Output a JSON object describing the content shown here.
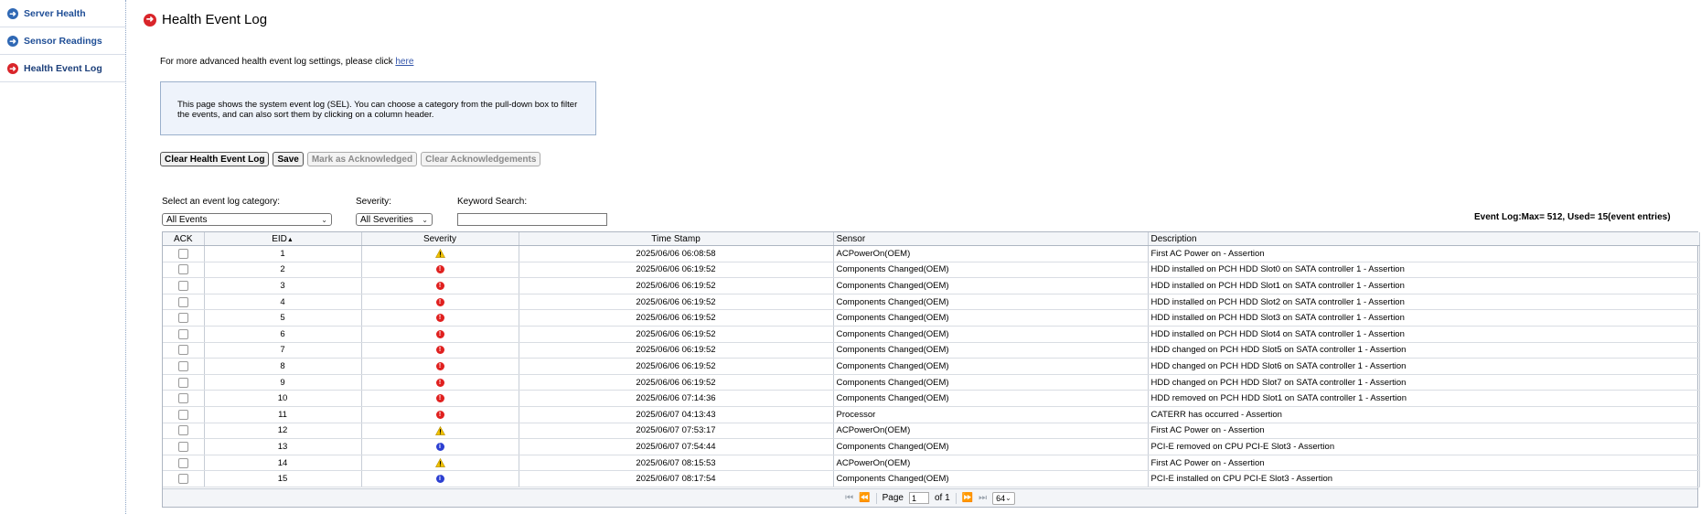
{
  "sidebar": {
    "items": [
      {
        "label": "Server Health",
        "icon": "arrow-right-circle-icon",
        "active": false
      },
      {
        "label": "Sensor Readings",
        "icon": "arrow-right-circle-icon",
        "active": false
      },
      {
        "label": "Health Event Log",
        "icon": "arrow-right-circle-icon",
        "active": true
      }
    ]
  },
  "page": {
    "title": "Health Event Log",
    "advanced_text": "For more advanced health event log settings, please click ",
    "advanced_link": "here",
    "info_text": "This page shows the system event log (SEL). You can choose a category from the pull-down box to filter the events, and can also sort them by clicking on a column header."
  },
  "toolbar": {
    "clear_log": "Clear Health Event Log",
    "save": "Save",
    "mark_ack": "Mark as Acknowledged",
    "clear_ack": "Clear Acknowledgements"
  },
  "filters": {
    "category_label": "Select an event log category:",
    "category_value": "All Events",
    "severity_label": "Severity:",
    "severity_value": "All Severities",
    "keyword_label": "Keyword Search:",
    "keyword_value": "",
    "log_summary": "Event Log:Max= 512, Used= 15(event entries)"
  },
  "table": {
    "headers": {
      "ack": "ACK",
      "eid": "EID",
      "severity": "Severity",
      "timestamp": "Time Stamp",
      "sensor": "Sensor",
      "description": "Description"
    },
    "rows": [
      {
        "eid": "1",
        "severity": "warning",
        "time": "2025/06/06 06:08:58",
        "sensor": "ACPowerOn(OEM)",
        "desc": "First AC Power on - Assertion"
      },
      {
        "eid": "2",
        "severity": "error",
        "time": "2025/06/06 06:19:52",
        "sensor": "Components Changed(OEM)",
        "desc": "HDD installed on PCH HDD Slot0 on SATA controller 1 - Assertion"
      },
      {
        "eid": "3",
        "severity": "error",
        "time": "2025/06/06 06:19:52",
        "sensor": "Components Changed(OEM)",
        "desc": "HDD installed on PCH HDD Slot1 on SATA controller 1 - Assertion"
      },
      {
        "eid": "4",
        "severity": "error",
        "time": "2025/06/06 06:19:52",
        "sensor": "Components Changed(OEM)",
        "desc": "HDD installed on PCH HDD Slot2 on SATA controller 1 - Assertion"
      },
      {
        "eid": "5",
        "severity": "error",
        "time": "2025/06/06 06:19:52",
        "sensor": "Components Changed(OEM)",
        "desc": "HDD installed on PCH HDD Slot3 on SATA controller 1 - Assertion"
      },
      {
        "eid": "6",
        "severity": "error",
        "time": "2025/06/06 06:19:52",
        "sensor": "Components Changed(OEM)",
        "desc": "HDD installed on PCH HDD Slot4 on SATA controller 1 - Assertion"
      },
      {
        "eid": "7",
        "severity": "error",
        "time": "2025/06/06 06:19:52",
        "sensor": "Components Changed(OEM)",
        "desc": "HDD changed on PCH HDD Slot5 on SATA controller 1 - Assertion"
      },
      {
        "eid": "8",
        "severity": "error",
        "time": "2025/06/06 06:19:52",
        "sensor": "Components Changed(OEM)",
        "desc": "HDD changed on PCH HDD Slot6 on SATA controller 1 - Assertion"
      },
      {
        "eid": "9",
        "severity": "error",
        "time": "2025/06/06 06:19:52",
        "sensor": "Components Changed(OEM)",
        "desc": "HDD changed on PCH HDD Slot7 on SATA controller 1 - Assertion"
      },
      {
        "eid": "10",
        "severity": "error",
        "time": "2025/06/06 07:14:36",
        "sensor": "Components Changed(OEM)",
        "desc": "HDD removed on PCH HDD Slot1 on SATA controller 1 - Assertion"
      },
      {
        "eid": "11",
        "severity": "error",
        "time": "2025/06/07 04:13:43",
        "sensor": "Processor",
        "desc": "CATERR has occurred - Assertion"
      },
      {
        "eid": "12",
        "severity": "warning",
        "time": "2025/06/07 07:53:17",
        "sensor": "ACPowerOn(OEM)",
        "desc": "First AC Power on - Assertion"
      },
      {
        "eid": "13",
        "severity": "info",
        "time": "2025/06/07 07:54:44",
        "sensor": "Components Changed(OEM)",
        "desc": "PCI-E removed on CPU PCI-E Slot3 - Assertion"
      },
      {
        "eid": "14",
        "severity": "warning",
        "time": "2025/06/07 08:15:53",
        "sensor": "ACPowerOn(OEM)",
        "desc": "First AC Power on - Assertion"
      },
      {
        "eid": "15",
        "severity": "info",
        "time": "2025/06/07 08:17:54",
        "sensor": "Components Changed(OEM)",
        "desc": "PCI-E installed on CPU PCI-E Slot3 - Assertion"
      }
    ]
  },
  "pager": {
    "page_label": "Page",
    "page_value": "1",
    "of_label": "of 1",
    "page_size": "64"
  },
  "colors": {
    "nav_blue": "#2f68b4",
    "nav_red": "#d9252a",
    "error": "#e0201f",
    "warning": "#f2c200",
    "info": "#2c3fd1"
  }
}
